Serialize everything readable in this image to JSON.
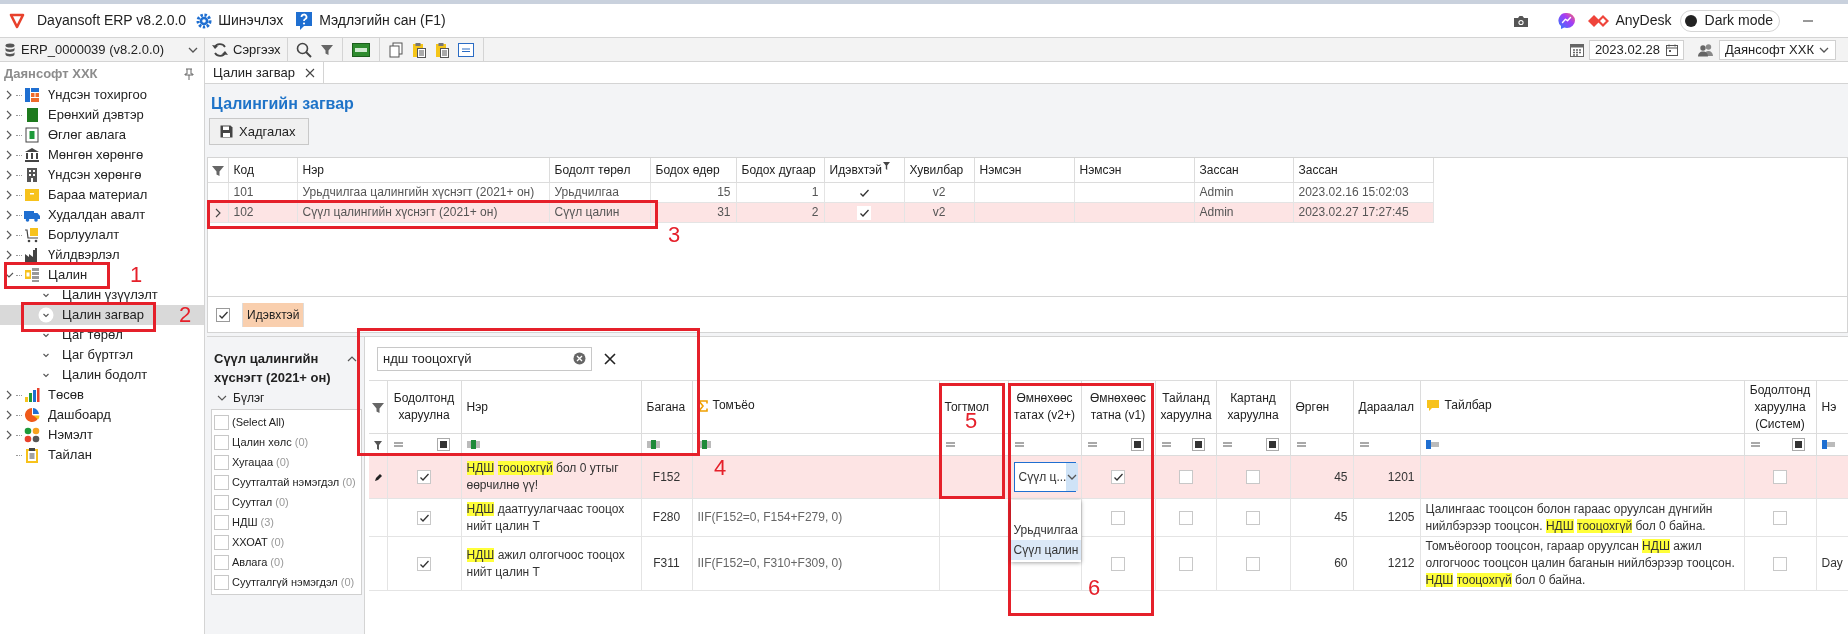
{
  "title_bar": {
    "app_title": "Dayansoft ERP v8.2.0.0",
    "update": "Шинэчлэх",
    "help": "Мэдлэгийн сан (F1)",
    "anydesk": "AnyDesk",
    "dark_mode": {
      "label": "Dark mode",
      "on": false
    }
  },
  "toolbar": {
    "database": "ERP_0000039 (v8.2.0.0)",
    "refresh": "Сэргээх",
    "date": "2023.02.28",
    "company": "Даянсофт ХХК"
  },
  "nav": {
    "title": "Даянсофт ХХК",
    "items": [
      {
        "label": "Үндсэн тохиргоо",
        "kind": "group",
        "expanded": false,
        "selected": false
      },
      {
        "label": "Ерөнхий дэвтэр",
        "kind": "group",
        "expanded": false,
        "selected": false
      },
      {
        "label": "Өглөг авлага",
        "kind": "group",
        "expanded": false,
        "selected": false
      },
      {
        "label": "Мөнгөн хөрөнгө",
        "kind": "group",
        "expanded": false,
        "selected": false
      },
      {
        "label": "Үндсэн хөрөнгө",
        "kind": "group",
        "expanded": false,
        "selected": false
      },
      {
        "label": "Бараа материал",
        "kind": "group",
        "expanded": false,
        "selected": false
      },
      {
        "label": "Худалдан авалт",
        "kind": "group",
        "expanded": false,
        "selected": false
      },
      {
        "label": "Борлуулалт",
        "kind": "group",
        "expanded": false,
        "selected": false
      },
      {
        "label": "Үйлдвэрлэл",
        "kind": "group",
        "expanded": false,
        "selected": false
      },
      {
        "label": "Цалин",
        "kind": "group",
        "expanded": true,
        "selected": false,
        "children": [
          {
            "label": "Цалин үзүүлэлт",
            "selected": false
          },
          {
            "label": "Цалин загвар",
            "selected": true
          },
          {
            "label": "Цаг төрөл",
            "selected": false
          },
          {
            "label": "Цаг бүртгэл",
            "selected": false
          },
          {
            "label": "Цалин бодолт",
            "selected": false
          }
        ]
      },
      {
        "label": "Төсөв",
        "kind": "group",
        "expanded": false,
        "selected": false
      },
      {
        "label": "Дашбоард",
        "kind": "group",
        "expanded": false,
        "selected": false
      },
      {
        "label": "Нэмэлт",
        "kind": "group",
        "expanded": false,
        "selected": false
      },
      {
        "label": "Тайлан",
        "kind": "leaf",
        "selected": false
      }
    ]
  },
  "tab": {
    "label": "Цалин загвар",
    "selected": true
  },
  "page_title": "Цалингийн загвар",
  "save_button": "Хадгалах",
  "templates": {
    "columns": [
      {
        "label": "Код",
        "kind": "text"
      },
      {
        "label": "Нэр",
        "kind": "text"
      },
      {
        "label": "Бодолт төрөл",
        "kind": "text"
      },
      {
        "label": "Бодох өдөр",
        "kind": "number"
      },
      {
        "label": "Бодох дугаар",
        "kind": "number"
      },
      {
        "label": "Идэвхтэй",
        "kind": "bool",
        "filtered": true
      },
      {
        "label": "Хувилбар",
        "kind": "center"
      },
      {
        "label": "Нэмсэн",
        "kind": "text"
      },
      {
        "label": "Нэмсэн",
        "kind": "text"
      },
      {
        "label": "Зассан",
        "kind": "text"
      },
      {
        "label": "Зассан",
        "kind": "text"
      }
    ],
    "rows": [
      {
        "selected": false,
        "cells": [
          "101",
          "Урьдчилгаа цалингийн хүснэгт (2021+ он)",
          "Урьдчилгаа",
          "15",
          "1",
          true,
          "v2",
          null,
          null,
          "Admin",
          "2023.02.16 15:02:03"
        ]
      },
      {
        "selected": true,
        "cells": [
          "102",
          "Сүүл цалингийн хүснэгт (2021+ он)",
          "Сүүл цалин",
          "31",
          "2",
          true,
          "v2",
          null,
          null,
          "Admin",
          "2023.02.27 17:27:45"
        ]
      }
    ],
    "filter": {
      "checked": true,
      "chip": "Идэвхтэй"
    }
  },
  "group_filter": {
    "title": "Сүүл цалингийн хүснэгт (2021+ он)",
    "group_label": "Бүлэг",
    "items": [
      {
        "label": "(Select All)",
        "checked": false
      },
      {
        "label": "Цалин хөлс",
        "count": "(0)",
        "checked": false
      },
      {
        "label": "Хугацаа",
        "count": "(0)",
        "checked": false
      },
      {
        "label": "Суутгалтай нэмэгдэл",
        "count": "(0)",
        "checked": false
      },
      {
        "label": "Суутгал",
        "count": "(0)",
        "checked": false
      },
      {
        "label": "НДШ",
        "count": "(3)",
        "checked": false
      },
      {
        "label": "ХХОАТ",
        "count": "(0)",
        "checked": false
      },
      {
        "label": "Авлага",
        "count": "(0)",
        "checked": false
      },
      {
        "label": "Суутгалгүй нэмэгдэл",
        "count": "(0)",
        "checked": false
      }
    ]
  },
  "fields": {
    "search": {
      "value": "ндш тооцохгүй"
    },
    "columns": [
      {
        "label": "Бодолтонд харуулна",
        "kind": "bool",
        "filter_mixed": true
      },
      {
        "label": "Нэр",
        "kind": "text"
      },
      {
        "label": "Багана",
        "kind": "code"
      },
      {
        "label": "Томъёо",
        "kind": "formula"
      },
      {
        "label": "Тогтмол",
        "kind": "number"
      },
      {
        "label": "Өмнөхөөс татах (v2+)",
        "kind": "combo"
      },
      {
        "label": "Өмнөхөөс татна (v1)",
        "kind": "bool",
        "filter_mixed": true
      },
      {
        "label": "Тайланд харуулна",
        "kind": "bool",
        "filter_mixed": true
      },
      {
        "label": "Картанд харуулна",
        "kind": "bool",
        "filter_mixed": true
      },
      {
        "label": "Өргөн",
        "kind": "number"
      },
      {
        "label": "Дараалал",
        "kind": "number"
      },
      {
        "label": "Тайлбар",
        "kind": "note"
      },
      {
        "label": "Бодолтонд харуулна (Систем)",
        "kind": "bool",
        "filter_mixed": true
      },
      {
        "label": "Нэ",
        "kind": "text"
      }
    ],
    "rows": [
      {
        "selected": true,
        "cells": [
          true,
          [
            {
              "text": "НДШ",
              "highlight": true
            },
            {
              "text": " ",
              "highlight": false
            },
            {
              "text": "тооцохгүй",
              "highlight": true
            },
            {
              "text": " бол 0 утгыг өөрчилнө үү!",
              "highlight": false
            }
          ],
          "F152",
          null,
          null,
          {
            "value": "Сүүл ц...",
            "open": true,
            "options": [
              {
                "label": "Урьдчилгаа",
                "selected": false
              },
              {
                "label": "Сүүл цалин",
                "selected": true
              }
            ]
          },
          true,
          false,
          false,
          "45",
          "1201",
          null,
          false,
          null
        ]
      },
      {
        "selected": false,
        "cells": [
          true,
          [
            {
              "text": "НДШ",
              "highlight": true
            },
            {
              "text": " даатгуулагчаас тооцох нийт цалин Т",
              "highlight": false
            }
          ],
          "F280",
          "IIF(F152=0, F154+F279, 0)",
          null,
          null,
          false,
          false,
          false,
          "45",
          "1205",
          [
            {
              "text": "Цалингаас тооцсон болон гараас оруулсан дүнгийн нийлбэрээр тооцсон. ",
              "highlight": false
            },
            {
              "text": "НДШ",
              "highlight": true
            },
            {
              "text": " ",
              "highlight": false
            },
            {
              "text": "тооцохгүй",
              "highlight": true
            },
            {
              "text": " бол 0 байна.",
              "highlight": false
            }
          ],
          false,
          null
        ]
      },
      {
        "selected": false,
        "cells": [
          true,
          [
            {
              "text": "НДШ",
              "highlight": true
            },
            {
              "text": " ажил олгогчоос тооцох нийт цалин Т",
              "highlight": false
            }
          ],
          "F311",
          "IIF(F152=0, F310+F309, 0)",
          null,
          null,
          false,
          false,
          false,
          "60",
          "1212",
          [
            {
              "text": "Томъёогоор тооцсон, гараар оруулсан ",
              "highlight": false
            },
            {
              "text": "НДШ",
              "highlight": true
            },
            {
              "text": " ажил олгогчоос тооцсон цалин баганын нийлбэрээр тооцсон. ",
              "highlight": false
            },
            {
              "text": "НДШ",
              "highlight": true
            },
            {
              "text": " ",
              "highlight": false
            },
            {
              "text": "тооцохгүй",
              "highlight": true
            },
            {
              "text": " бол 0 байна.",
              "highlight": false
            }
          ],
          false,
          "Day"
        ]
      }
    ]
  },
  "annotations": [
    {
      "label": "1"
    },
    {
      "label": "2"
    },
    {
      "label": "3"
    },
    {
      "label": "4"
    },
    {
      "label": "5"
    },
    {
      "label": "6"
    }
  ]
}
